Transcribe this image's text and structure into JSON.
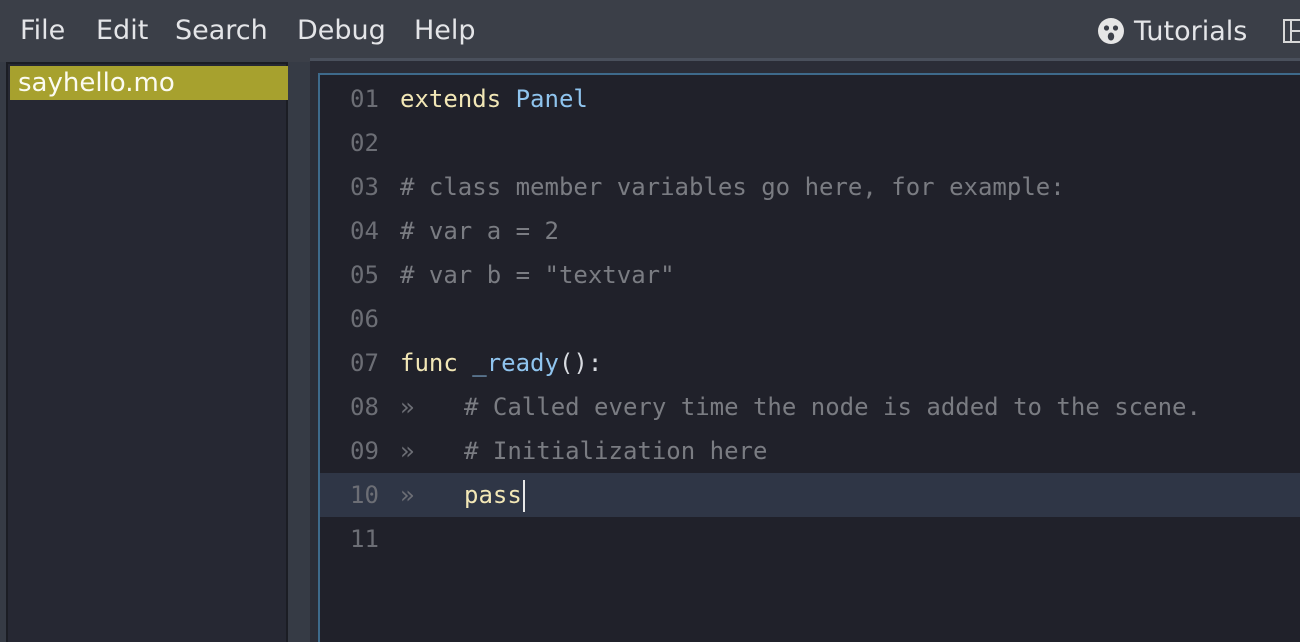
{
  "menu": {
    "items": [
      "File",
      "Edit",
      "Search",
      "Debug",
      "Help"
    ],
    "tutorials_label": "Tutorials",
    "tutorials_icon": "help-face-icon",
    "dock_icon": "dock-split-icon"
  },
  "files": {
    "items": [
      {
        "name": "sayhello.mo",
        "selected": true
      }
    ]
  },
  "editor": {
    "lines": [
      {
        "number": "01",
        "tokens": [
          {
            "text": "extends",
            "kind": "keyword"
          },
          {
            "text": " ",
            "kind": "plain"
          },
          {
            "text": "Panel",
            "kind": "type"
          }
        ]
      },
      {
        "number": "02",
        "tokens": []
      },
      {
        "number": "03",
        "tokens": [
          {
            "text": "# class member variables go here, for example:",
            "kind": "comment"
          }
        ]
      },
      {
        "number": "04",
        "tokens": [
          {
            "text": "# var a = 2",
            "kind": "comment"
          }
        ]
      },
      {
        "number": "05",
        "tokens": [
          {
            "text": "# var b = \"textvar\"",
            "kind": "comment"
          }
        ]
      },
      {
        "number": "06",
        "tokens": []
      },
      {
        "number": "07",
        "tokens": [
          {
            "text": "func",
            "kind": "keyword"
          },
          {
            "text": " ",
            "kind": "plain"
          },
          {
            "text": "_ready",
            "kind": "function"
          },
          {
            "text": "():",
            "kind": "plain"
          }
        ]
      },
      {
        "number": "08",
        "indent": true,
        "tokens": [
          {
            "text": "# Called every time the node is added to the scene.",
            "kind": "comment"
          }
        ]
      },
      {
        "number": "09",
        "indent": true,
        "tokens": [
          {
            "text": "# Initialization here",
            "kind": "comment"
          }
        ]
      },
      {
        "number": "10",
        "indent": true,
        "current": true,
        "cursor": true,
        "tokens": [
          {
            "text": "pass",
            "kind": "keyword"
          }
        ]
      },
      {
        "number": "11",
        "tokens": []
      }
    ],
    "tab_marker": "»"
  },
  "colors": {
    "accent_selected_file": "#a7a12e",
    "editor_bg": "#20212a",
    "current_line_bg": "#2f3646",
    "keyword": "#f2e7b6",
    "type": "#8fc4ee",
    "comment": "#7a7c82"
  }
}
